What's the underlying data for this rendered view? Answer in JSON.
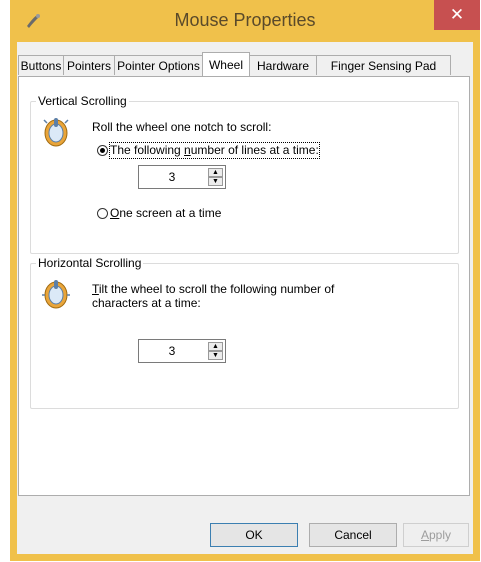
{
  "window": {
    "title": "Mouse Properties",
    "close_glyph": "✕",
    "frame_color": "#f0c14b",
    "close_color": "#c75050"
  },
  "tabs": [
    {
      "label": "Buttons",
      "active": false
    },
    {
      "label": "Pointers",
      "active": false
    },
    {
      "label": "Pointer Options",
      "active": false
    },
    {
      "label": "Wheel",
      "active": true
    },
    {
      "label": "Hardware",
      "active": false
    },
    {
      "label": "Finger Sensing Pad",
      "active": false
    }
  ],
  "vertical": {
    "group_label": "Vertical Scrolling",
    "description": "Roll the wheel one notch to scroll:",
    "option_lines": {
      "before": "The following ",
      "accel": "n",
      "after": "umber of lines at a time:",
      "selected": true
    },
    "lines_value": "3",
    "option_screen": {
      "accel": "O",
      "after": "ne screen at a time",
      "selected": false
    }
  },
  "horizontal": {
    "group_label": "Horizontal Scrolling",
    "description_line1": {
      "accel": "T",
      "after": "ilt the wheel to scroll the following number of"
    },
    "description_line2": "characters at a time:",
    "chars_value": "3"
  },
  "buttons": {
    "ok": "OK",
    "cancel": "Cancel",
    "apply": {
      "accel": "A",
      "after": "pply"
    }
  }
}
